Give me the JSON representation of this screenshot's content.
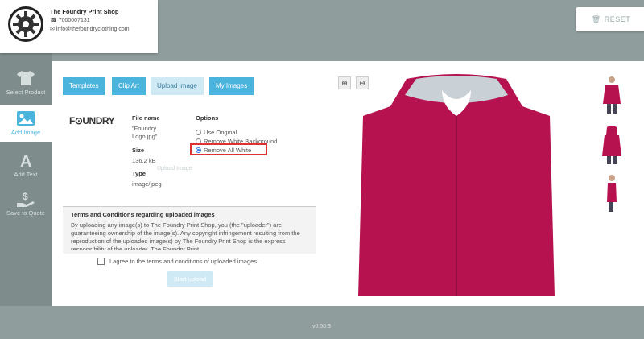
{
  "shop": {
    "name": "The Foundry Print Shop",
    "email": "info@thefoundryclothing.com",
    "phone": "7000007131"
  },
  "reset_label": "RESET",
  "sidebar": {
    "items": [
      {
        "label": "Select Product",
        "icon": "tshirt-icon"
      },
      {
        "label": "Add Image",
        "icon": "image-icon"
      },
      {
        "label": "Add Text",
        "icon": "text-icon"
      },
      {
        "label": "Save to Quote",
        "icon": "dollar-hand-icon"
      }
    ],
    "active": "Add Image"
  },
  "tabs": [
    {
      "label": "Templates"
    },
    {
      "label": "Clip Art"
    },
    {
      "label": "Upload Image"
    },
    {
      "label": "My Images"
    }
  ],
  "active_tab": "Upload Image",
  "file": {
    "logo_text": "F⊙UNDRY",
    "name_label": "File name",
    "name_value": "\"Foundry Logo.jpg\"",
    "size_label": "Size",
    "size_value": "136.2 kB",
    "type_label": "Type",
    "type_value": "image/jpeg",
    "ghost_text": "Upload Image"
  },
  "options": {
    "label": "Options",
    "choices": [
      "Use Original",
      "Remove White Background",
      "Remove All White"
    ],
    "selected": "Remove All White"
  },
  "terms": {
    "title": "Terms and Conditions regarding uploaded images",
    "text": "By uploading any image(s) to The Foundry Print Shop, you (the \"uploader\") are guaranteeing ownership of the image(s). Any copyright infringement resulting from the reproduction of the uploaded image(s) by The Foundry Print Shop is the express responsibility of the uploader. The Foundry Print",
    "agree_label": "I agree to the terms and conditions of uploaded images."
  },
  "start_upload_label": "Start upload",
  "product": {
    "color": "#b5124f",
    "hood_lining": "#c9d1d6"
  },
  "version": "v0.50.3"
}
